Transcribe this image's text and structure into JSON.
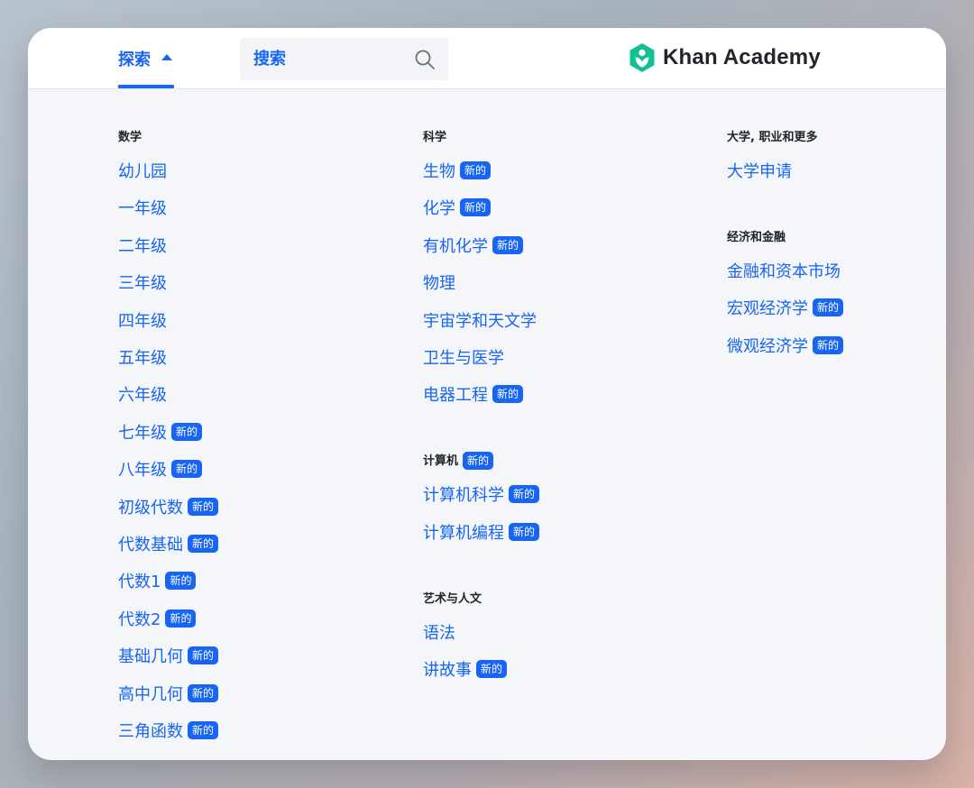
{
  "header": {
    "explore_label": "探索",
    "search_placeholder": "搜索",
    "logo_text": "Khan Academy",
    "brand_color": "#1865f2",
    "logo_color": "#14bf96"
  },
  "badge_label": "新的",
  "columns": [
    {
      "sections": [
        {
          "title": "数学",
          "items": [
            {
              "label": "幼儿园",
              "new": false
            },
            {
              "label": "一年级",
              "new": false
            },
            {
              "label": "二年级",
              "new": false
            },
            {
              "label": "三年级",
              "new": false
            },
            {
              "label": "四年级",
              "new": false
            },
            {
              "label": "五年级",
              "new": false
            },
            {
              "label": "六年级",
              "new": false
            },
            {
              "label": "七年级",
              "new": true
            },
            {
              "label": "八年级",
              "new": true
            },
            {
              "label": "初级代数",
              "new": true
            },
            {
              "label": "代数基础",
              "new": true
            },
            {
              "label": "代数1",
              "new": true
            },
            {
              "label": "代数2",
              "new": true
            },
            {
              "label": "基础几何",
              "new": true
            },
            {
              "label": "高中几何",
              "new": true
            },
            {
              "label": "三角函数",
              "new": true
            }
          ]
        }
      ]
    },
    {
      "sections": [
        {
          "title": "科学",
          "items": [
            {
              "label": "生物",
              "new": true
            },
            {
              "label": "化学",
              "new": true
            },
            {
              "label": "有机化学",
              "new": true
            },
            {
              "label": "物理",
              "new": false
            },
            {
              "label": "宇宙学和天文学",
              "new": false
            },
            {
              "label": "卫生与医学",
              "new": false
            },
            {
              "label": "电器工程",
              "new": true
            }
          ]
        },
        {
          "title": "计算机",
          "title_new": true,
          "items": [
            {
              "label": "计算机科学",
              "new": true
            },
            {
              "label": "计算机编程",
              "new": true
            }
          ]
        },
        {
          "title": "艺术与人文",
          "items": [
            {
              "label": "语法",
              "new": false
            },
            {
              "label": "讲故事",
              "new": true
            }
          ]
        }
      ]
    },
    {
      "sections": [
        {
          "title": "大学, 职业和更多",
          "items": [
            {
              "label": "大学申请",
              "new": false
            }
          ]
        },
        {
          "title": "经济和金融",
          "items": [
            {
              "label": "金融和资本市场",
              "new": false
            },
            {
              "label": "宏观经济学",
              "new": true
            },
            {
              "label": "微观经济学",
              "new": true
            }
          ]
        }
      ]
    }
  ]
}
